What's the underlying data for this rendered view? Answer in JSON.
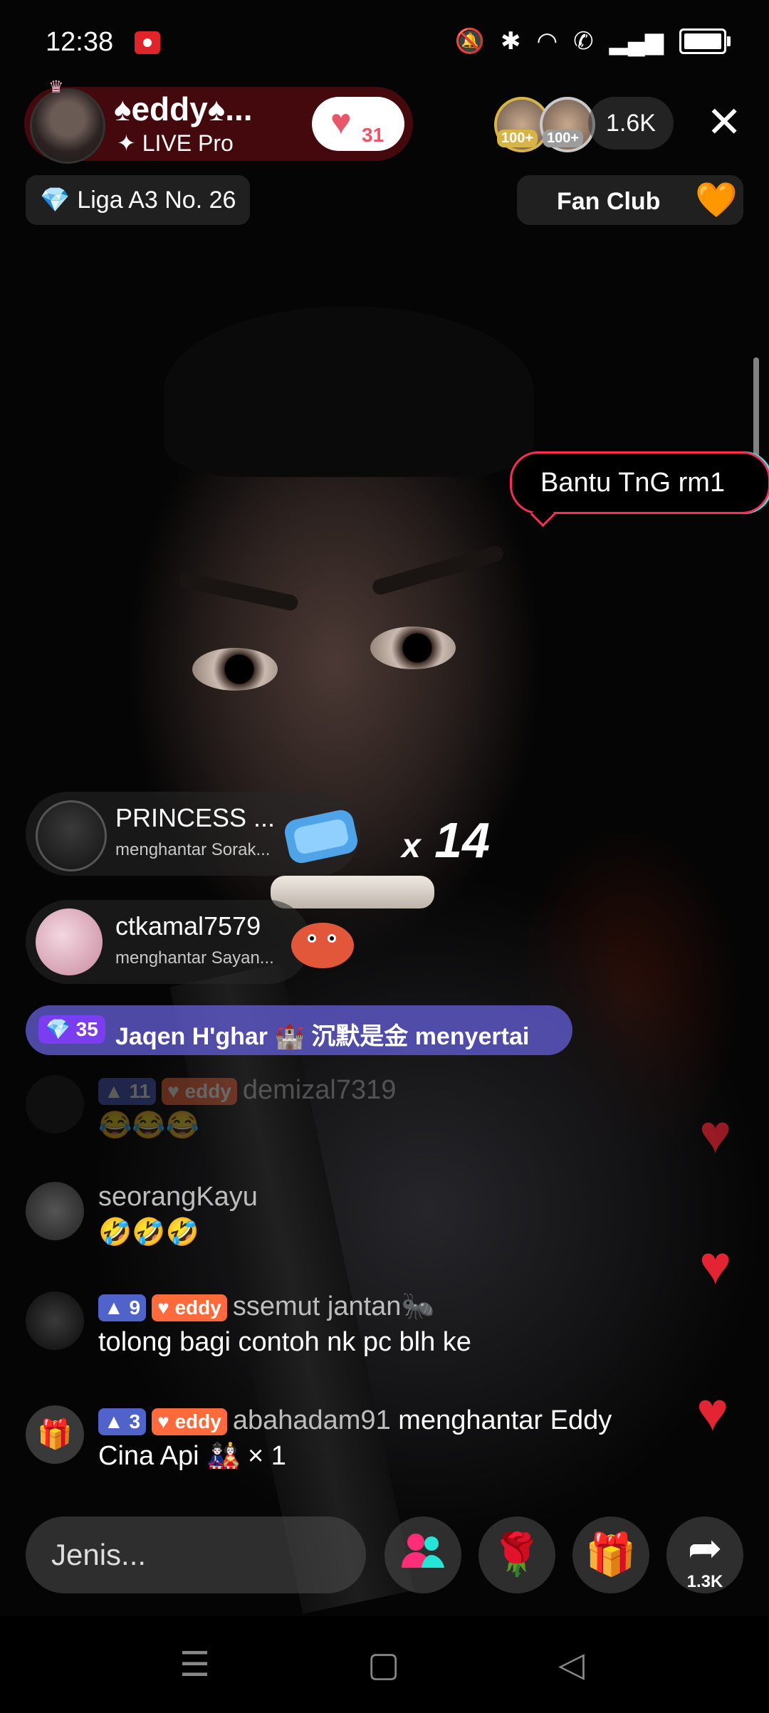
{
  "status_bar": {
    "time": "12:38",
    "icons": [
      "mute-icon",
      "bluetooth-icon",
      "wifi-icon",
      "call-icon",
      "signal-icon",
      "battery-icon"
    ]
  },
  "host": {
    "name": "♠eddy♠...",
    "subtitle": "✦ LIVE Pro",
    "likes": "31"
  },
  "viewers": {
    "badge1": "100+",
    "badge2": "100+",
    "count": "1.6K"
  },
  "league": {
    "icon": "💎",
    "label": "Liga A3 No. 26"
  },
  "fan_club": {
    "label": "Fan Club"
  },
  "bubble": {
    "text": "Bantu TnG rm1"
  },
  "gifts": [
    {
      "name": "PRINCESS ...",
      "sub": "menghantar Sorak..."
    },
    {
      "name": "ctkamal7579",
      "sub": "menghantar Sayan..."
    }
  ],
  "combo": {
    "prefix": "x",
    "count": "14"
  },
  "join": {
    "level": "35",
    "text": "Jaqen H'ghar 🏰  沉默是金 menyertai"
  },
  "chat": [
    {
      "level": "11",
      "fan": "eddy",
      "user": "demizal7319",
      "text": "😂😂😂"
    },
    {
      "user": "seorangKayu",
      "text": "🤣🤣🤣"
    },
    {
      "level": "9",
      "fan": "eddy",
      "user": "ssemut jantan🐜",
      "text": "tolong bagi contoh nk pc blh ke"
    },
    {
      "level": "3",
      "fan": "eddy",
      "user": "abahadam91",
      "text_inline": "menghantar Eddy",
      "text": "Cina Api 🎎 × 1"
    }
  ],
  "bottom_bar": {
    "input_placeholder": "Jenis...",
    "share_count": "1.3K"
  },
  "colors": {
    "accent_red": "#ff2d55",
    "accent_cyan": "#25f4ee",
    "heart": "#e32432"
  }
}
